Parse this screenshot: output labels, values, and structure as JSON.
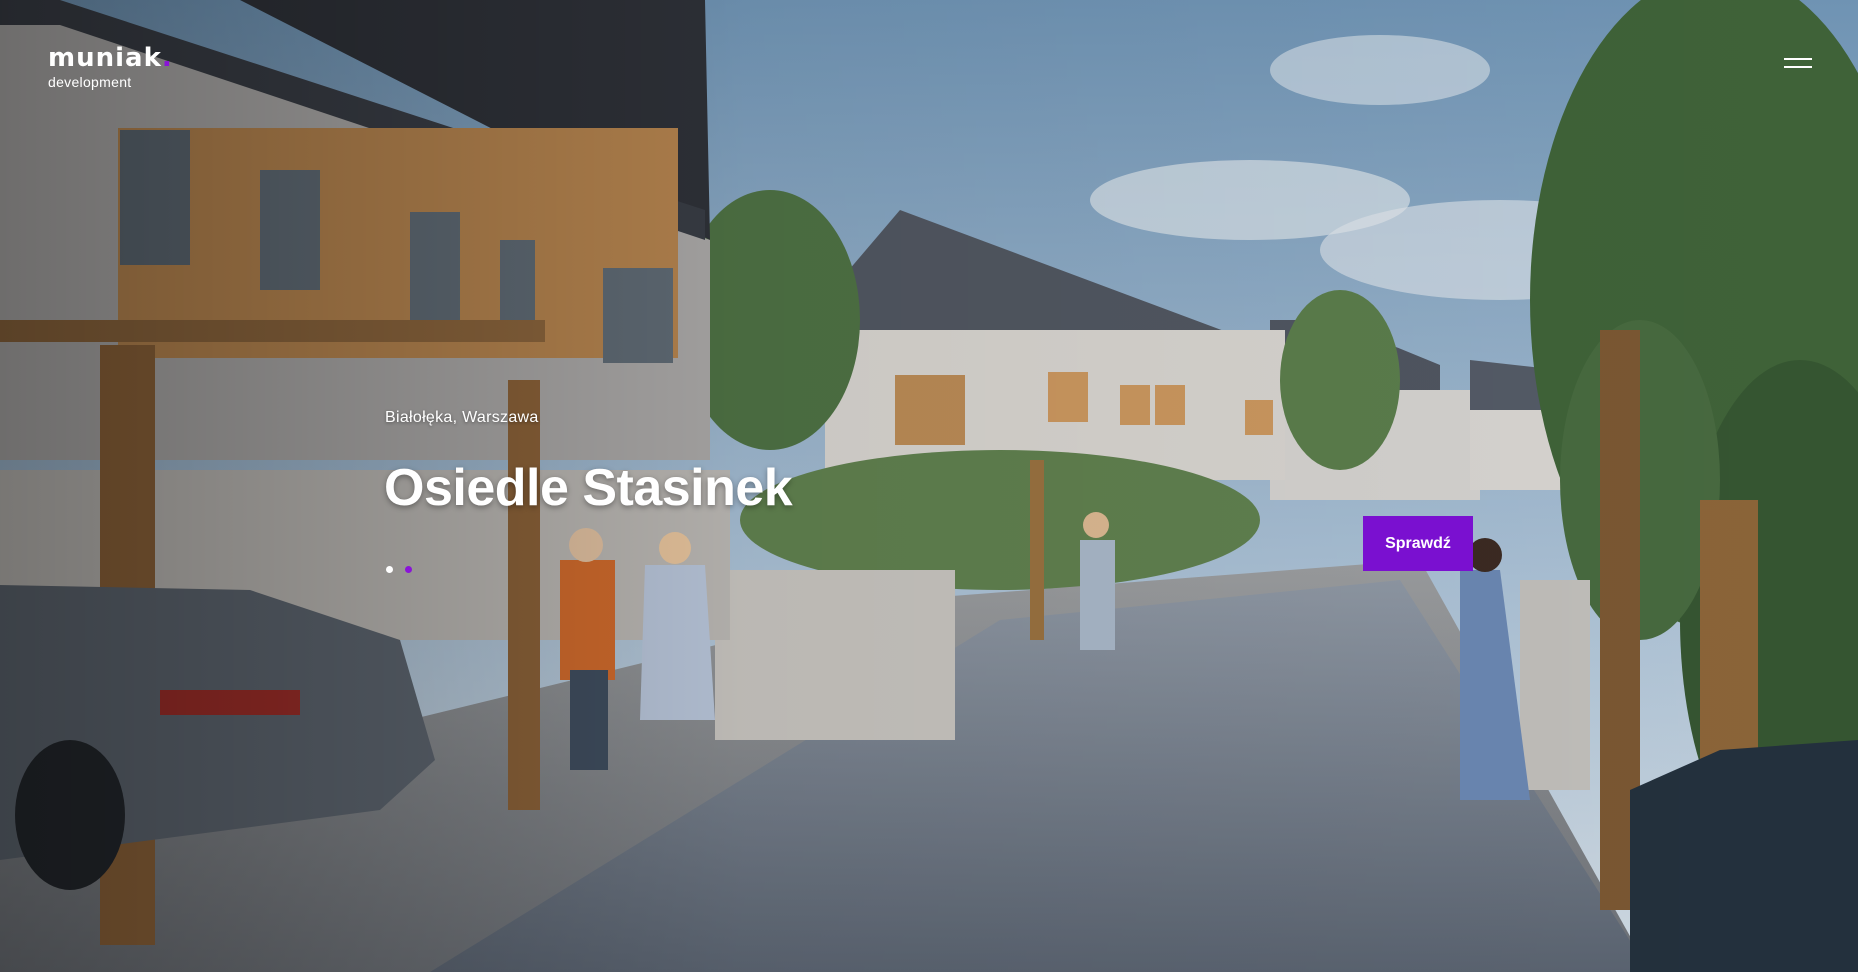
{
  "brand": {
    "logo_text": "muniak",
    "logo_dot": ".",
    "logo_sub": "development",
    "accent": "#7a10d0"
  },
  "header": {
    "menu_icon": "hamburger-menu-icon"
  },
  "hero": {
    "location": "Białołęka, Warszawa",
    "title": "Osiedle Stasinek",
    "cta_label": "Sprawdź",
    "slides_total": 2,
    "active_slide": 2
  }
}
